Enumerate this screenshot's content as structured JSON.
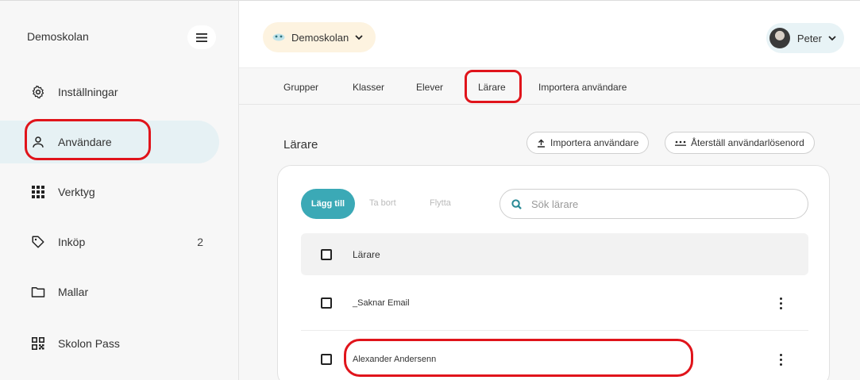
{
  "sidebar": {
    "school_name": "Demoskolan",
    "items": [
      {
        "label": "Inställningar",
        "icon": "gear-icon"
      },
      {
        "label": "Användare",
        "icon": "user-icon",
        "active": true
      },
      {
        "label": "Verktyg",
        "icon": "grid-icon"
      },
      {
        "label": "Inköp",
        "icon": "tag-icon",
        "count": "2"
      },
      {
        "label": "Mallar",
        "icon": "folder-icon"
      },
      {
        "label": "Skolon Pass",
        "icon": "qr-icon"
      }
    ]
  },
  "topbar": {
    "school_selector": "Demoskolan",
    "user_name": "Peter"
  },
  "tabs": [
    "Grupper",
    "Klasser",
    "Elever",
    "Lärare",
    "Importera användare"
  ],
  "active_tab": "Lärare",
  "main": {
    "title": "Lärare",
    "import_button": "Importera användare",
    "reset_button": "Återställ användarlösenord",
    "add_button": "Lägg till",
    "remove_button": "Ta bort",
    "move_button": "Flytta",
    "search_placeholder": "Sök lärare",
    "table": {
      "header": "Lärare",
      "rows": [
        "_Saknar Email",
        "Alexander Andersenn"
      ]
    }
  },
  "colors": {
    "accent": "#3ba9b6",
    "sidebar_bg": "#f7f7f7",
    "active_item_bg": "#e6f1f4",
    "annotation": "#e0141b"
  }
}
